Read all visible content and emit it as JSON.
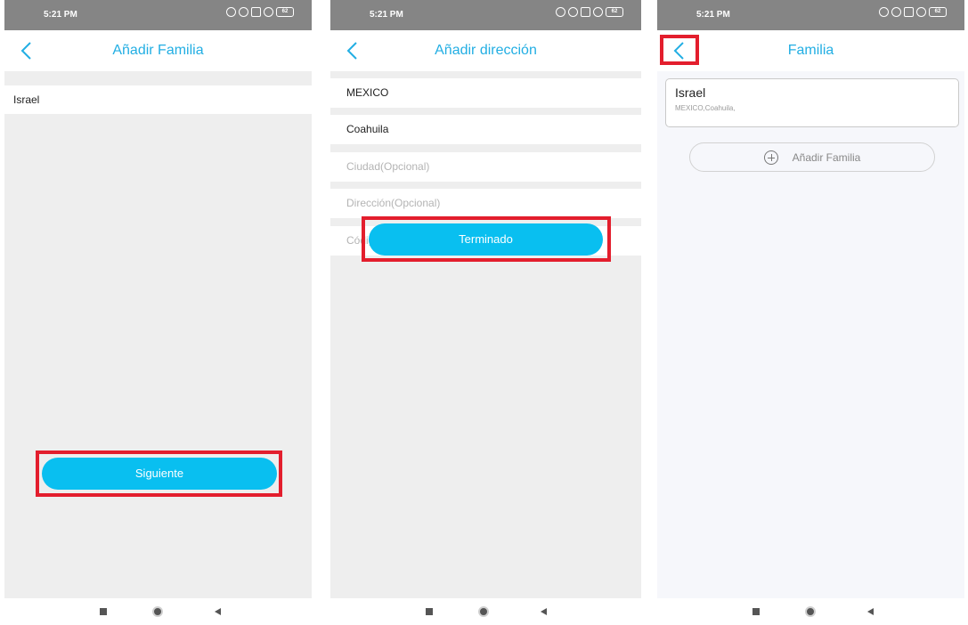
{
  "status_bar": {
    "time": "5:21 PM",
    "battery": "62"
  },
  "screen1": {
    "title": "Añadir Familia",
    "family_name": "Israel",
    "next_button": "Siguiente"
  },
  "screen2": {
    "title": "Añadir dirección",
    "country": "MEXICO",
    "state": "Coahuila",
    "city_placeholder": "Ciudad(Opcional)",
    "address_placeholder": "Dirección(Opcional)",
    "postal_placeholder": "Código postal (Opcional)",
    "done_button": "Terminado"
  },
  "screen3": {
    "title": "Familia",
    "family_card": {
      "name": "Israel",
      "address": "MEXICO,Coahuila,"
    },
    "add_family_button": "Añadir Familia"
  },
  "colors": {
    "accent": "#09bff0",
    "title": "#22aee3",
    "highlight": "#e31e2d"
  },
  "icons": [
    "back-chevron-icon",
    "plus-circle-icon",
    "nav-recent-icon",
    "nav-home-icon",
    "nav-back-icon"
  ]
}
